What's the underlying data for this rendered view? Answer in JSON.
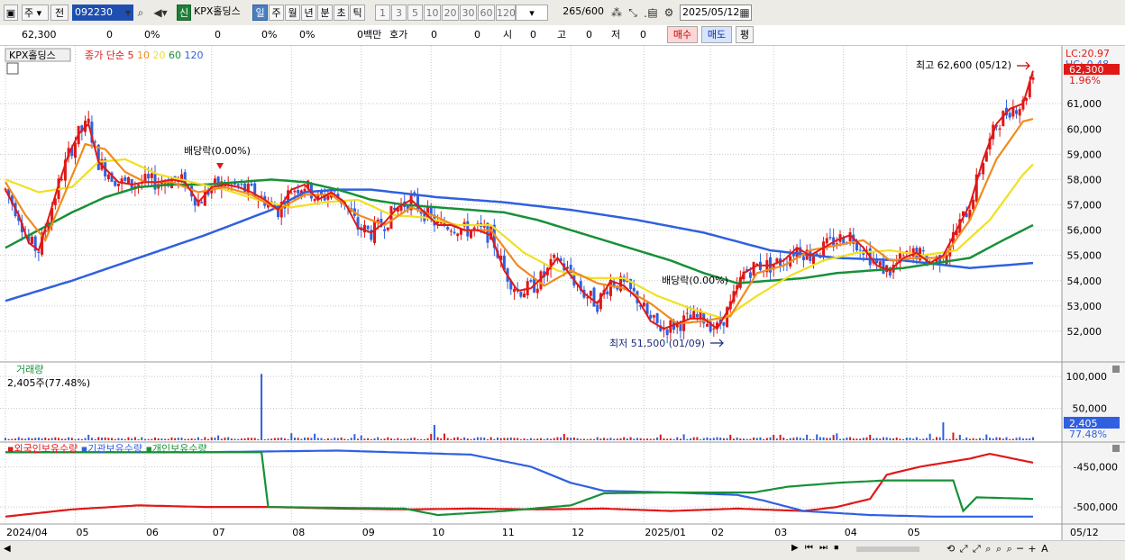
{
  "toolbar": {
    "period_select": "주",
    "prev_label": "전",
    "code": "092230",
    "badge": "신",
    "name": "KPX홀딩스",
    "periods": [
      "일",
      "주",
      "월",
      "년",
      "분",
      "초",
      "틱"
    ],
    "period_selected": "일",
    "intervals": [
      "1",
      "3",
      "5",
      "10",
      "20",
      "30",
      "60",
      "120"
    ],
    "count": "265",
    "count_max": "/600",
    "date": "2025/05/12"
  },
  "quote": {
    "price": "62,300",
    "change": "0",
    "change_pct": "0%",
    "volume": "0",
    "vol_pct": "0%",
    "vol_pct2": "0%",
    "amount": "0백만",
    "ask_label": "호가",
    "ask1": "0",
    "ask2": "0",
    "open_label": "시",
    "open": "0",
    "high_label": "고",
    "high": "0",
    "low_label": "저",
    "low": "0",
    "buy": "매수",
    "sell": "매도",
    "eval": "평"
  },
  "chart_data": [
    {
      "type": "candlestick",
      "title": "KPX홀딩스",
      "legend": [
        "종가 단순",
        "5",
        "10",
        "20",
        "60",
        "120"
      ],
      "legend_colors": {
        "5": "#e01818",
        "10": "#f08c1e",
        "20": "#f0e020",
        "60": "#189038",
        "120": "#3060e0"
      },
      "x_ticks": [
        "2024/04",
        "05",
        "06",
        "07",
        "08",
        "09",
        "10",
        "11",
        "12",
        "2025/01",
        "02",
        "03",
        "04",
        "05",
        "05/12"
      ],
      "y_ticks": [
        52000,
        53000,
        54000,
        55000,
        56000,
        57000,
        58000,
        59000,
        60000,
        61000
      ],
      "ylim": [
        51000,
        63000
      ],
      "annotations": {
        "high": "최고 62,600 (05/12)",
        "low": "최저 51,500 (01/09)",
        "dividend1": "배당락(0.00%)",
        "dividend2": "배당락(0.00%)",
        "lc": "LC:20.97",
        "hc": "HC:-0.48",
        "last_price": "62,300",
        "last_pct": "1.96%"
      },
      "ma_values": {
        "ma5": [
          [
            0,
            57600
          ],
          [
            4,
            56600
          ],
          [
            7,
            55500
          ],
          [
            10,
            55200
          ],
          [
            13,
            56500
          ],
          [
            16,
            57800
          ],
          [
            19,
            59000
          ],
          [
            22,
            59800
          ],
          [
            25,
            60200
          ],
          [
            28,
            58700
          ],
          [
            31,
            58300
          ],
          [
            34,
            57900
          ],
          [
            38,
            57800
          ],
          [
            42,
            57900
          ],
          [
            46,
            57900
          ],
          [
            50,
            58000
          ],
          [
            54,
            57900
          ],
          [
            58,
            57100
          ],
          [
            62,
            57700
          ],
          [
            66,
            57800
          ],
          [
            70,
            57700
          ],
          [
            74,
            57500
          ],
          [
            78,
            57200
          ],
          [
            82,
            56800
          ],
          [
            86,
            57600
          ],
          [
            90,
            57800
          ],
          [
            94,
            57200
          ],
          [
            98,
            57500
          ],
          [
            102,
            57100
          ],
          [
            106,
            56100
          ],
          [
            110,
            55900
          ],
          [
            114,
            56300
          ],
          [
            118,
            56900
          ],
          [
            122,
            57200
          ],
          [
            126,
            56700
          ],
          [
            130,
            56200
          ],
          [
            134,
            56200
          ],
          [
            138,
            56000
          ],
          [
            142,
            56000
          ],
          [
            146,
            55800
          ],
          [
            150,
            54400
          ],
          [
            154,
            53600
          ],
          [
            158,
            53700
          ],
          [
            162,
            54200
          ],
          [
            166,
            54900
          ],
          [
            170,
            54200
          ],
          [
            174,
            53500
          ],
          [
            178,
            53100
          ],
          [
            182,
            54000
          ],
          [
            186,
            53800
          ],
          [
            190,
            53300
          ],
          [
            194,
            52400
          ],
          [
            198,
            52100
          ],
          [
            202,
            52300
          ],
          [
            206,
            52500
          ],
          [
            210,
            52500
          ],
          [
            214,
            52100
          ],
          [
            218,
            53000
          ],
          [
            222,
            54300
          ],
          [
            226,
            54600
          ],
          [
            230,
            54600
          ],
          [
            234,
            54800
          ],
          [
            238,
            55300
          ],
          [
            242,
            55000
          ],
          [
            246,
            55300
          ],
          [
            250,
            55600
          ],
          [
            254,
            55800
          ],
          [
            258,
            55300
          ],
          [
            262,
            54600
          ],
          [
            266,
            54400
          ],
          [
            270,
            54900
          ],
          [
            274,
            55100
          ],
          [
            278,
            54700
          ],
          [
            282,
            55000
          ],
          [
            286,
            56000
          ],
          [
            290,
            57000
          ],
          [
            294,
            58800
          ],
          [
            298,
            60200
          ],
          [
            302,
            60800
          ],
          [
            306,
            61000
          ],
          [
            309,
            62300
          ]
        ],
        "ma10": [
          [
            0,
            57900
          ],
          [
            6,
            56600
          ],
          [
            12,
            55600
          ],
          [
            18,
            57500
          ],
          [
            24,
            59400
          ],
          [
            30,
            59200
          ],
          [
            36,
            58300
          ],
          [
            42,
            57900
          ],
          [
            50,
            57900
          ],
          [
            58,
            57500
          ],
          [
            66,
            57700
          ],
          [
            74,
            57400
          ],
          [
            82,
            56800
          ],
          [
            90,
            57400
          ],
          [
            98,
            57400
          ],
          [
            106,
            56600
          ],
          [
            114,
            56200
          ],
          [
            122,
            56900
          ],
          [
            130,
            56500
          ],
          [
            138,
            56000
          ],
          [
            146,
            56000
          ],
          [
            154,
            54600
          ],
          [
            162,
            53800
          ],
          [
            170,
            54400
          ],
          [
            178,
            53900
          ],
          [
            186,
            53700
          ],
          [
            194,
            53100
          ],
          [
            202,
            52300
          ],
          [
            210,
            52400
          ],
          [
            218,
            52600
          ],
          [
            226,
            54300
          ],
          [
            234,
            54600
          ],
          [
            242,
            55200
          ],
          [
            250,
            55400
          ],
          [
            258,
            55600
          ],
          [
            266,
            54800
          ],
          [
            274,
            54900
          ],
          [
            282,
            54900
          ],
          [
            290,
            56400
          ],
          [
            298,
            58800
          ],
          [
            306,
            60300
          ],
          [
            309,
            60400
          ]
        ],
        "ma20": [
          [
            0,
            58000
          ],
          [
            10,
            57500
          ],
          [
            20,
            57700
          ],
          [
            28,
            58700
          ],
          [
            36,
            58800
          ],
          [
            46,
            58200
          ],
          [
            56,
            57900
          ],
          [
            66,
            57600
          ],
          [
            76,
            57200
          ],
          [
            86,
            56900
          ],
          [
            96,
            57100
          ],
          [
            106,
            57200
          ],
          [
            116,
            56600
          ],
          [
            126,
            56500
          ],
          [
            136,
            56200
          ],
          [
            146,
            56200
          ],
          [
            156,
            55100
          ],
          [
            166,
            54400
          ],
          [
            176,
            54100
          ],
          [
            186,
            54100
          ],
          [
            196,
            53400
          ],
          [
            206,
            52900
          ],
          [
            216,
            52500
          ],
          [
            226,
            53400
          ],
          [
            236,
            54200
          ],
          [
            246,
            54800
          ],
          [
            256,
            55100
          ],
          [
            266,
            55200
          ],
          [
            276,
            55000
          ],
          [
            286,
            55200
          ],
          [
            296,
            56400
          ],
          [
            306,
            58200
          ],
          [
            309,
            58600
          ]
        ],
        "ma60": [
          [
            0,
            55300
          ],
          [
            10,
            56000
          ],
          [
            20,
            56700
          ],
          [
            30,
            57300
          ],
          [
            40,
            57700
          ],
          [
            50,
            57800
          ],
          [
            60,
            57800
          ],
          [
            70,
            57900
          ],
          [
            80,
            58000
          ],
          [
            90,
            57900
          ],
          [
            100,
            57600
          ],
          [
            110,
            57200
          ],
          [
            120,
            57000
          ],
          [
            130,
            56900
          ],
          [
            140,
            56800
          ],
          [
            150,
            56700
          ],
          [
            160,
            56400
          ],
          [
            170,
            56000
          ],
          [
            180,
            55600
          ],
          [
            190,
            55200
          ],
          [
            200,
            54800
          ],
          [
            210,
            54300
          ],
          [
            220,
            53900
          ],
          [
            230,
            54000
          ],
          [
            240,
            54100
          ],
          [
            250,
            54300
          ],
          [
            260,
            54400
          ],
          [
            270,
            54500
          ],
          [
            280,
            54700
          ],
          [
            290,
            54900
          ],
          [
            300,
            55600
          ],
          [
            309,
            56200
          ]
        ],
        "ma120": [
          [
            0,
            53200
          ],
          [
            20,
            54000
          ],
          [
            40,
            54900
          ],
          [
            60,
            55800
          ],
          [
            80,
            56800
          ],
          [
            90,
            57500
          ],
          [
            100,
            57600
          ],
          [
            110,
            57600
          ],
          [
            130,
            57300
          ],
          [
            150,
            57100
          ],
          [
            170,
            56800
          ],
          [
            190,
            56400
          ],
          [
            210,
            55900
          ],
          [
            230,
            55200
          ],
          [
            250,
            54900
          ],
          [
            270,
            54800
          ],
          [
            290,
            54500
          ],
          [
            309,
            54700
          ]
        ]
      }
    },
    {
      "type": "bar",
      "title": "거래량",
      "subtitle": "2,405주(77.48%)",
      "y_ticks": [
        50000,
        100000
      ],
      "ylim": [
        0,
        110000
      ],
      "last_value": "2,405",
      "last_pct": "77.48%",
      "spikes": [
        [
          77,
          104000
        ],
        [
          129,
          24000
        ],
        [
          282,
          28000
        ],
        [
          285,
          12000
        ]
      ]
    },
    {
      "type": "line",
      "legend": [
        "외국인보유수량",
        "기관보유수량",
        "개인보유수량"
      ],
      "legend_colors": [
        "#e01818",
        "#3060e0",
        "#189038"
      ],
      "y_ticks": [
        -450000,
        -500000
      ],
      "series": [
        {
          "name": "외국인보유수량",
          "color": "#e01818",
          "points": [
            [
              0,
              -512000
            ],
            [
              20,
              -503000
            ],
            [
              40,
              -498000
            ],
            [
              60,
              -500000
            ],
            [
              80,
              -500000
            ],
            [
              100,
              -502000
            ],
            [
              120,
              -503000
            ],
            [
              140,
              -502000
            ],
            [
              160,
              -503000
            ],
            [
              180,
              -502000
            ],
            [
              200,
              -505000
            ],
            [
              220,
              -502000
            ],
            [
              240,
              -505000
            ],
            [
              250,
              -500000
            ],
            [
              260,
              -490000
            ],
            [
              265,
              -460000
            ],
            [
              275,
              -450000
            ],
            [
              290,
              -440000
            ],
            [
              296,
              -434000
            ],
            [
              309,
              -445000
            ]
          ]
        },
        {
          "name": "기관보유수량",
          "color": "#3060e0",
          "points": [
            [
              0,
              -432000
            ],
            [
              60,
              -432000
            ],
            [
              100,
              -430000
            ],
            [
              140,
              -435000
            ],
            [
              158,
              -450000
            ],
            [
              170,
              -470000
            ],
            [
              180,
              -480000
            ],
            [
              200,
              -482000
            ],
            [
              220,
              -485000
            ],
            [
              228,
              -492000
            ],
            [
              240,
              -505000
            ],
            [
              260,
              -510000
            ],
            [
              280,
              -512000
            ],
            [
              309,
              -512000
            ]
          ]
        },
        {
          "name": "개인보유수량",
          "color": "#189038",
          "points": [
            [
              0,
              -432000
            ],
            [
              77,
              -432000
            ],
            [
              79,
              -500000
            ],
            [
              120,
              -502000
            ],
            [
              130,
              -510000
            ],
            [
              150,
              -505000
            ],
            [
              170,
              -498000
            ],
            [
              180,
              -483000
            ],
            [
              200,
              -482000
            ],
            [
              225,
              -482000
            ],
            [
              235,
              -475000
            ],
            [
              250,
              -470000
            ],
            [
              265,
              -467000
            ],
            [
              285,
              -467000
            ],
            [
              288,
              -505000
            ],
            [
              292,
              -488000
            ],
            [
              309,
              -490000
            ]
          ]
        }
      ]
    }
  ]
}
